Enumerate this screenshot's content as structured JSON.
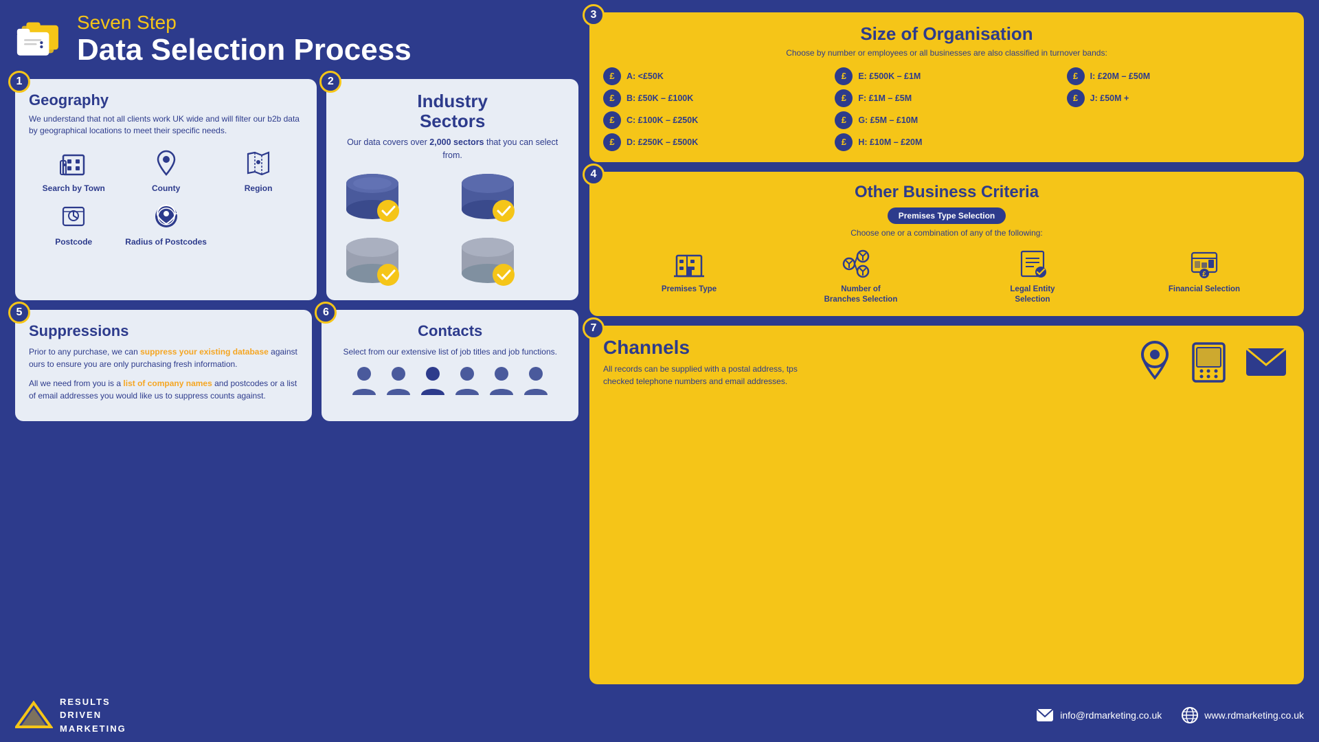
{
  "header": {
    "subtitle": "Seven Step",
    "title": "Data Selection Process"
  },
  "steps": {
    "step1": {
      "number": "1",
      "title": "Geography",
      "desc": "We understand that not all clients work UK wide and will filter our b2b data by geographical locations to meet their specific needs.",
      "icons": [
        {
          "label": "Search by Town",
          "icon": "building"
        },
        {
          "label": "County",
          "icon": "location"
        },
        {
          "label": "Region",
          "icon": "region"
        },
        {
          "label": "Postcode",
          "icon": "postcode"
        },
        {
          "label": "Radius of Postcodes",
          "icon": "radius"
        }
      ]
    },
    "step2": {
      "number": "2",
      "title": "Industry Sectors",
      "desc_plain": "Our data covers over ",
      "desc_bold": "2,000 sectors",
      "desc_end": " that you can select from."
    },
    "step3": {
      "number": "3",
      "title": "Size of Organisation",
      "subtitle": "Choose by number or employees or all businesses are also classified in turnover bands:",
      "bands": [
        {
          "label": "A: <£50K"
        },
        {
          "label": "E: £500K – £1M"
        },
        {
          "label": "I: £20M – £50M"
        },
        {
          "label": "B: £50K – £100K"
        },
        {
          "label": "F: £1M – £5M"
        },
        {
          "label": "J: £50M +"
        },
        {
          "label": "C: £100K – £250K"
        },
        {
          "label": "G: £5M – £10M"
        },
        {
          "label": ""
        },
        {
          "label": "D: £250K – £500K"
        },
        {
          "label": "H: £10M – £20M"
        },
        {
          "label": ""
        }
      ]
    },
    "step4": {
      "number": "4",
      "title": "Other Business Criteria",
      "premises_badge": "Premises Type Selection",
      "subtitle": "Choose one or a combination of any of the following:",
      "criteria": [
        {
          "label": "Premises Type"
        },
        {
          "label": "Number of Branches Selection"
        },
        {
          "label": "Legal Entity Selection"
        },
        {
          "label": "Financial Selection"
        }
      ]
    },
    "step5": {
      "number": "5",
      "title": "Suppressions",
      "body1": "Prior to any purchase, we can ",
      "body1_link": "suppress your existing database",
      "body1_end": " against ours to ensure you are only purchasing fresh information.",
      "body2_start": "All we need from you is a ",
      "body2_link": "list of company names",
      "body2_end": " and postcodes or a list of email addresses you would like us to suppress counts against."
    },
    "step6": {
      "number": "6",
      "title": "Contacts",
      "desc": "Select from our extensive list of job titles and job functions."
    },
    "step7": {
      "number": "7",
      "title": "Channels",
      "desc": "All records can be supplied with a postal address, tps checked telephone numbers and email addresses."
    }
  },
  "footer": {
    "company_line1": "RESULTS",
    "company_line2": "DRIVEN",
    "company_line3": "MARKETING",
    "email": "info@rdmarketing.co.uk",
    "website": "www.rdmarketing.co.uk"
  }
}
